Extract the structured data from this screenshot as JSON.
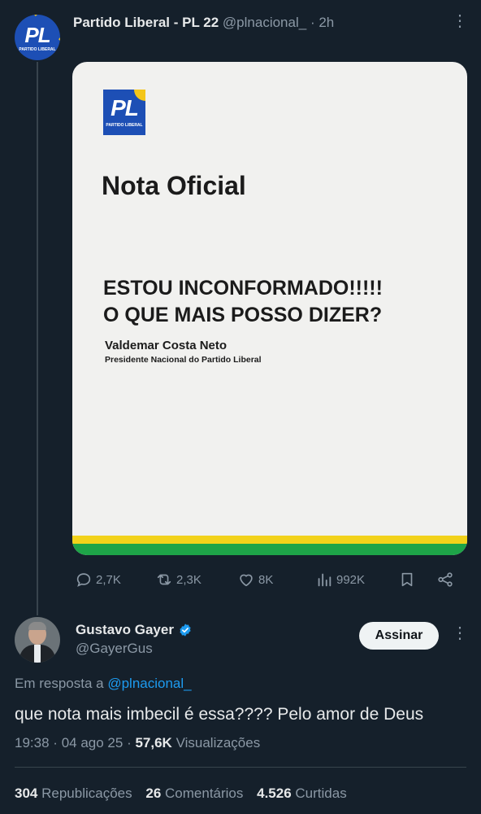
{
  "original_tweet": {
    "avatar": {
      "text": "PL",
      "subtext": "PARTIDO LIBERAL"
    },
    "display_name": "Partido Liberal - PL 22",
    "handle": "@plnacional_",
    "separator": "·",
    "time": "2h",
    "more_icon": "more-vertical-icon",
    "image": {
      "logo_text": "PL",
      "logo_subtext": "PARTIDO LIBERAL",
      "title": "Nota Oficial",
      "headline_line1": "ESTOU INCONFORMADO!!!!!",
      "headline_line2": "O QUE MAIS POSSO DIZER?",
      "signer": "Valdemar Costa Neto",
      "signer_role": "Presidente Nacional do Partido Liberal",
      "band_colors": [
        "#f2d21a",
        "#1ea448"
      ]
    },
    "actions": {
      "replies": "2,7K",
      "retweets": "2,3K",
      "likes": "8K",
      "views": "992K"
    }
  },
  "reply_tweet": {
    "display_name": "Gustavo Gayer",
    "verified": true,
    "handle": "@GayerGus",
    "follow_label": "Assinar",
    "reply_prefix": "Em resposta a",
    "reply_handle": "@plnacional_",
    "text": "que nota mais imbecil é essa???? Pelo amor de Deus",
    "time": "19:38",
    "date": "04 ago 25",
    "views_count": "57,6K",
    "views_label": "Visualizações",
    "stats": {
      "reposts_count": "304",
      "reposts_label": "Republicações",
      "comments_count": "26",
      "comments_label": "Comentários",
      "likes_count": "4.526",
      "likes_label": "Curtidas"
    }
  },
  "colors": {
    "background": "#15202b",
    "text": "#e7e9ea",
    "muted": "#8b98a5",
    "link": "#1d9bf0",
    "verified": "#1d9bf0"
  }
}
